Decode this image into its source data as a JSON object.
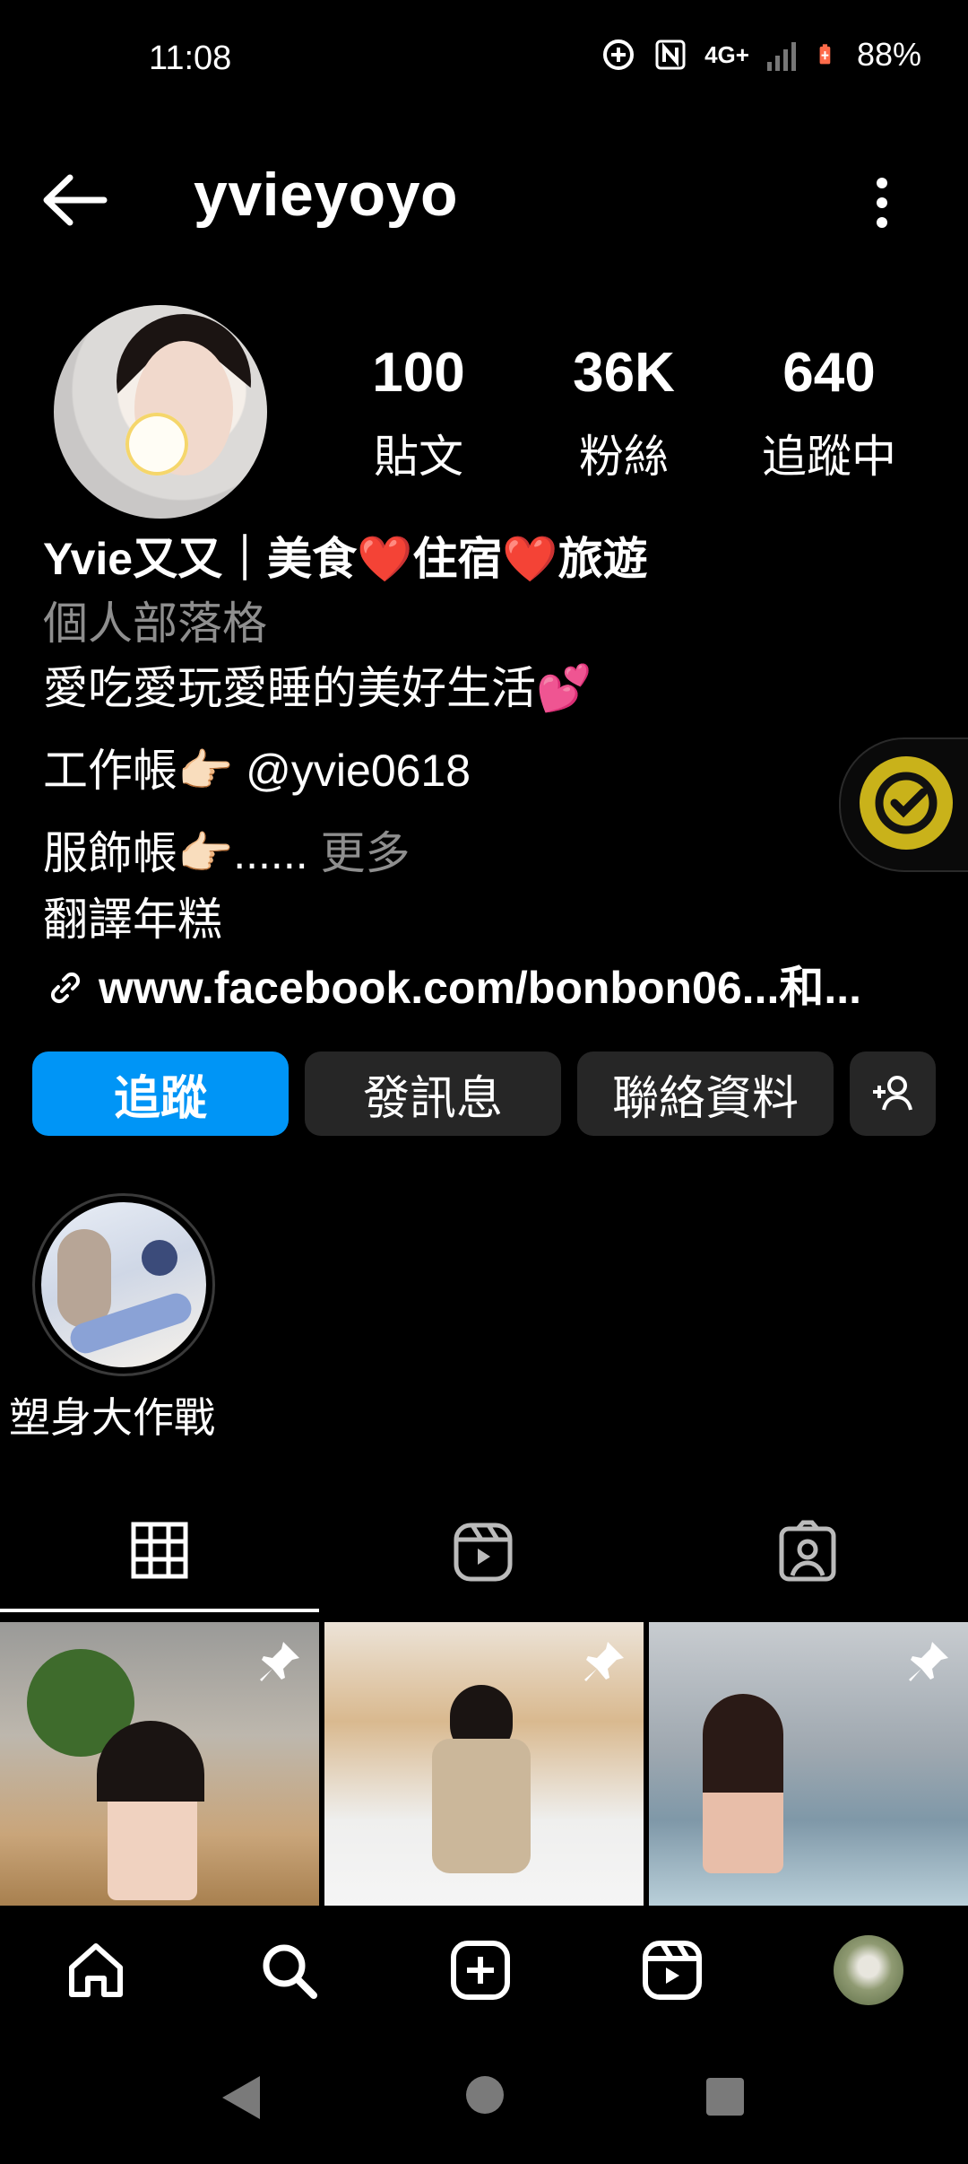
{
  "status_bar": {
    "time": "11:08",
    "battery": "88%",
    "network": "4G+"
  },
  "header": {
    "username": "yvieyoyo"
  },
  "profile": {
    "stats": [
      {
        "value": "100",
        "label": "貼文"
      },
      {
        "value": "36K",
        "label": "粉絲"
      },
      {
        "value": "640",
        "label": "追蹤中"
      }
    ],
    "name": "Yvie又又｜美食❤️住宿❤️旅遊",
    "category": "個人部落格",
    "bio_line1": "愛吃愛玩愛睡的美好生活💕",
    "bio_line2": "工作帳👉🏻 @yvie0618",
    "bio_line3_prefix": "服飾帳👉🏻......",
    "bio_more": "更多",
    "translate": "翻譯年糕",
    "link": "www.facebook.com/bonbon06...和..."
  },
  "actions": {
    "follow": "追蹤",
    "message": "發訊息",
    "contact": "聯絡資料"
  },
  "highlights": [
    {
      "label": "塑身大作戰"
    }
  ],
  "tabs": [
    "posts-grid",
    "reels",
    "tagged"
  ],
  "nav": [
    "home",
    "search",
    "create",
    "reels",
    "profile"
  ],
  "colors": {
    "accent": "#0095f6",
    "background": "#000000",
    "button": "#262626"
  }
}
